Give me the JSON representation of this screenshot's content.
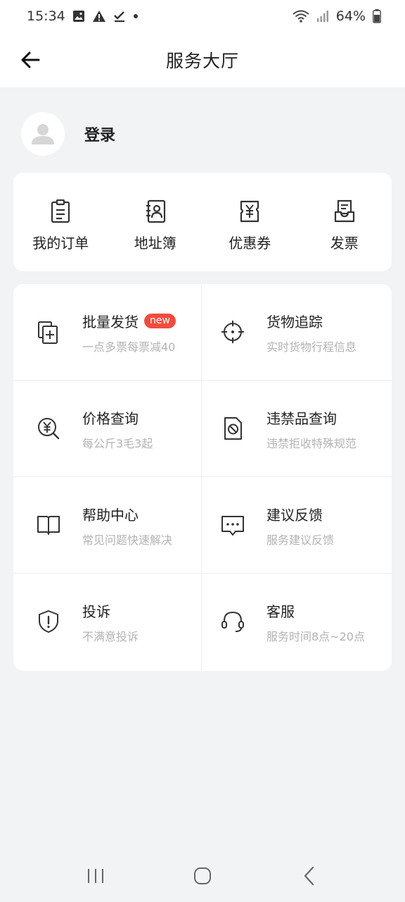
{
  "status": {
    "time": "15:34",
    "battery": "64%"
  },
  "header": {
    "title": "服务大厅"
  },
  "profile": {
    "login_label": "登录"
  },
  "quick_actions": [
    {
      "label": "我的订单",
      "icon": "clipboard-icon"
    },
    {
      "label": "地址簿",
      "icon": "address-book-icon"
    },
    {
      "label": "优惠券",
      "icon": "coupon-icon"
    },
    {
      "label": "发票",
      "icon": "invoice-icon"
    }
  ],
  "services": [
    {
      "title": "批量发货",
      "subtitle": "一点多票每票减40",
      "badge": "new",
      "icon": "batch-shipping-icon"
    },
    {
      "title": "货物追踪",
      "subtitle": "实时货物行程信息",
      "icon": "crosshair-icon"
    },
    {
      "title": "价格查询",
      "subtitle": "每公斤3毛3起",
      "icon": "price-search-icon"
    },
    {
      "title": "违禁品查询",
      "subtitle": "违禁拒收特殊规范",
      "icon": "prohibited-icon"
    },
    {
      "title": "帮助中心",
      "subtitle": "常见问题快速解决",
      "icon": "book-icon"
    },
    {
      "title": "建议反馈",
      "subtitle": "服务建议反馈",
      "icon": "feedback-icon"
    },
    {
      "title": "投诉",
      "subtitle": "不满意投诉",
      "icon": "shield-alert-icon"
    },
    {
      "title": "客服",
      "subtitle": "服务时间8点~20点",
      "icon": "headset-icon"
    }
  ],
  "colors": {
    "accent_badge": "#f04c3e",
    "background": "#f2f3f5",
    "card": "#ffffff"
  }
}
